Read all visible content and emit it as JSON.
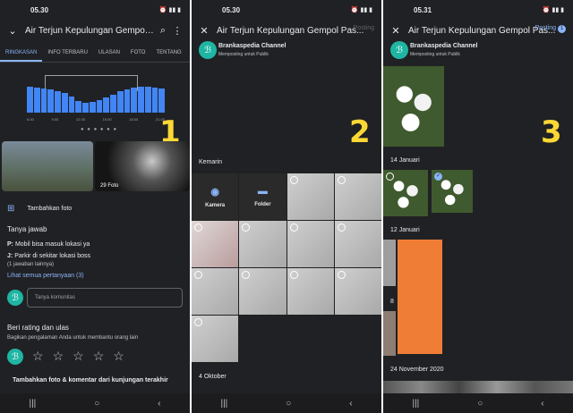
{
  "screens": [
    {
      "status_time": "05.30",
      "title": "Air Terjun Kepulungan Gempol Pas...",
      "tabs": [
        "RINGKASAN",
        "INFO TERBARU",
        "ULASAN",
        "FOTO",
        "TENTANG"
      ],
      "step": "1",
      "photo_count": "29 Foto",
      "add_photo": "Tambahkan foto",
      "qa_heading": "Tanya jawab",
      "q_prefix": "P:",
      "q_text": "Mobil bisa masuk lokasi ya",
      "a_prefix": "J:",
      "a_text": "Parkir di sekitar lokasi boss",
      "a_more": "(1 jawaban lainnya)",
      "see_all": "Lihat semua pertanyaan (3)",
      "ask_placeholder": "Tanya komunitas",
      "rate_heading": "Beri rating dan ulas",
      "rate_sub": "Bagikan pengalaman Anda untuk membantu orang lain",
      "add_comment": "Tambahkan foto & komentar dari kunjungan terakhir",
      "chart_axis": [
        "6.00",
        "9.00",
        "12.00",
        "15.00",
        "18.00",
        "21.00"
      ],
      "chart_levels": [
        0.72,
        0.7,
        0.68,
        0.66,
        0.6,
        0.55,
        0.45,
        0.32,
        0.28,
        0.3,
        0.35,
        0.42,
        0.5,
        0.6,
        0.66,
        0.7,
        0.72,
        0.72,
        0.7,
        0.68
      ]
    },
    {
      "status_time": "05.30",
      "title": "Air Terjun Kepulungan Gempol Pas...",
      "channel": "Brankaspedia Channel",
      "public": "Memposting untuk Publik",
      "post": "Posting",
      "step": "2",
      "section_yesterday": "Kemarin",
      "camera": "Kamera",
      "folder": "Folder",
      "section_oct": "4 Oktober"
    },
    {
      "status_time": "05.31",
      "title": "Air Terjun Kepulungan Gempol Pas...",
      "channel": "Brankaspedia Channel",
      "public": "Memposting untuk Publik",
      "post": "Posting",
      "post_count": "1",
      "step": "3",
      "section_jan14": "14 Januari",
      "section_jan12": "12 Januari",
      "section_8": "8",
      "section_nov": "24 November 2020"
    }
  ]
}
